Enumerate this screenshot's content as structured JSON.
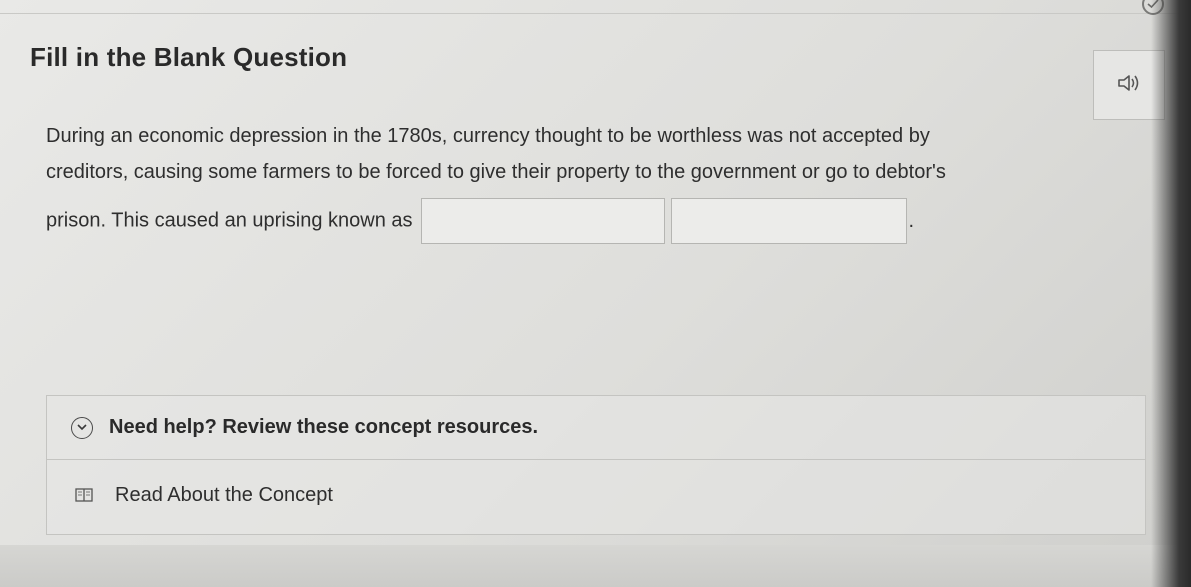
{
  "header": {
    "title": "Fill in the Blank Question"
  },
  "icons": {
    "top_check": "check-circle-icon",
    "audio": "speaker-icon",
    "expand": "chevron-down-icon",
    "concept": "book-icon"
  },
  "question": {
    "line1": "During an economic depression in the 1780s, currency thought to be worthless was not accepted by",
    "line2": "creditors, causing some farmers to be forced to give their property to the government or go to debtor's",
    "line3": "prison. This caused an uprising known as",
    "blank1_value": "",
    "blank2_value": "",
    "end_punctuation": "."
  },
  "help": {
    "header": "Need help? Review these concept resources.",
    "link": "Read About the Concept"
  }
}
